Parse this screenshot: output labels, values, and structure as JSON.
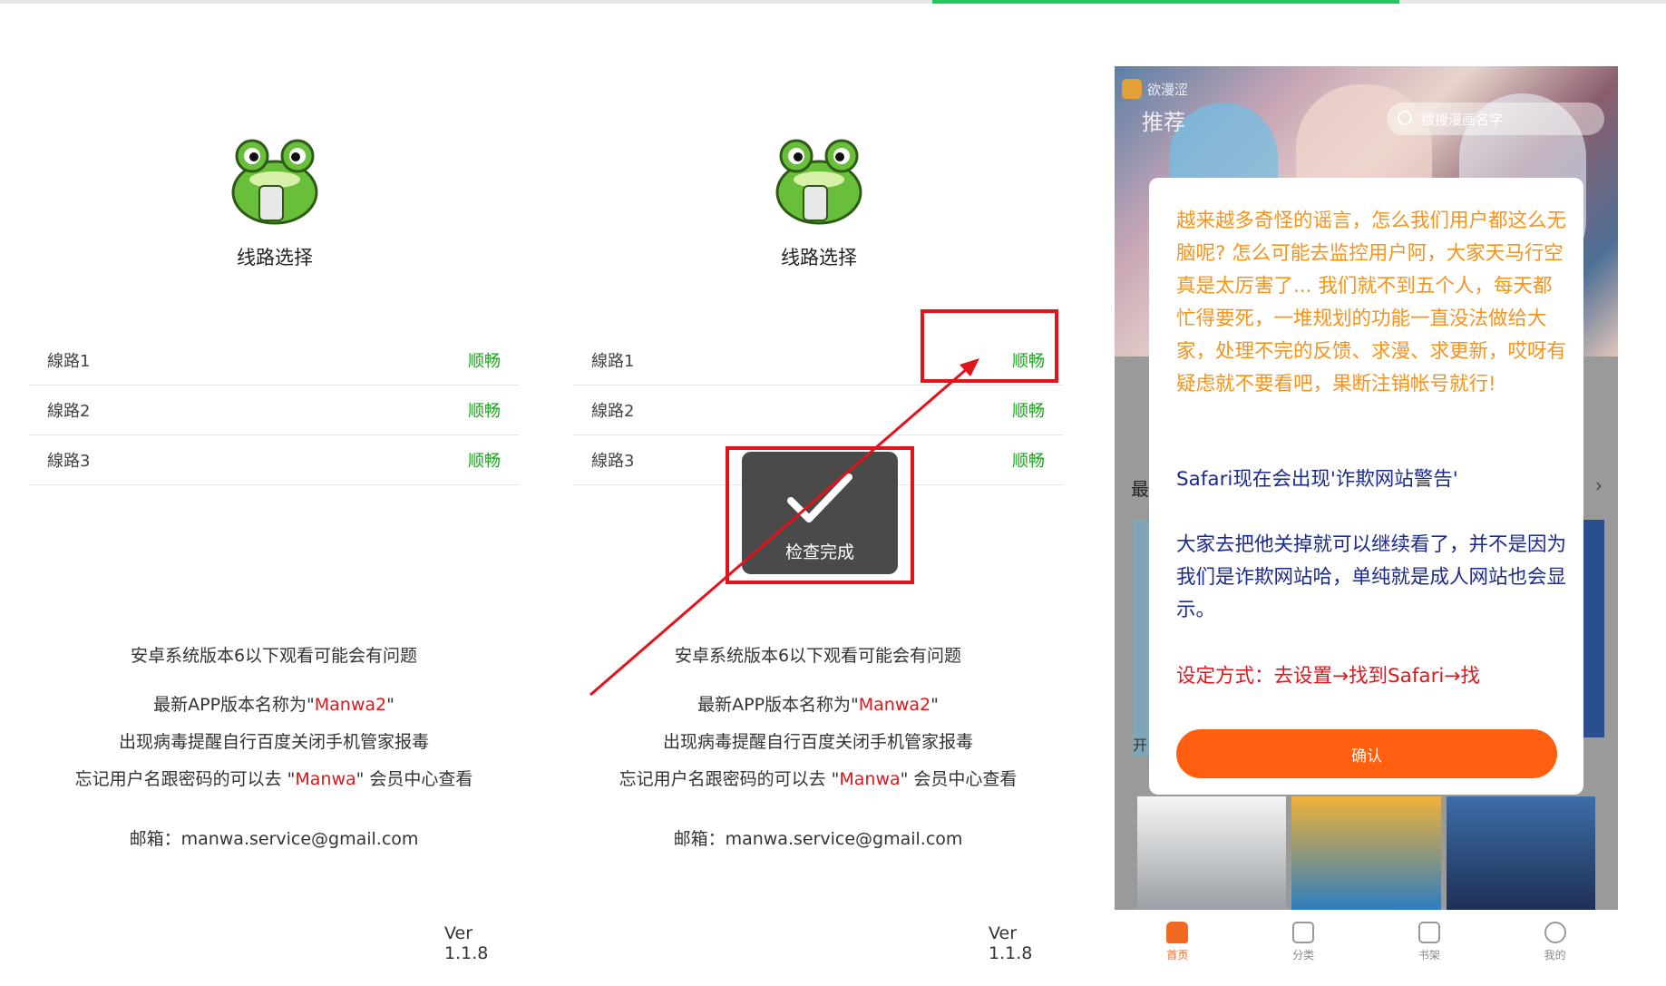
{
  "left_screen": {
    "title": "线路选择",
    "routes": [
      {
        "name": "線路1",
        "status": "顺畅"
      },
      {
        "name": "線路2",
        "status": "顺畅"
      },
      {
        "name": "線路3",
        "status": "顺畅"
      }
    ],
    "note1": "安卓系统版本6以下观看可能会有问题",
    "note2_pre": "最新APP版本名称为\"",
    "note2_red": "Manwa2",
    "note2_post": "\"",
    "note3": "出现病毒提醒自行百度关闭手机管家报毒",
    "note4_pre": "忘记用户名跟密码的可以去 \"",
    "note4_red": "Manwa",
    "note4_post": "\" 会员中心查看",
    "email": "邮箱：manwa.service@gmail.com",
    "version": "Ver 1.1.8"
  },
  "middle_screen": {
    "title": "线路选择",
    "routes": [
      {
        "name": "線路1",
        "status": "顺畅"
      },
      {
        "name": "線路2",
        "status": "顺畅"
      },
      {
        "name": "線路3",
        "status": "顺畅"
      }
    ],
    "toast": "检查完成",
    "note1": "安卓系统版本6以下观看可能会有问题",
    "note2_pre": "最新APP版本名称为\"",
    "note2_red": "Manwa2",
    "note2_post": "\"",
    "note3": "出现病毒提醒自行百度关闭手机管家报毒",
    "note4_pre": "忘记用户名跟密码的可以去 \"",
    "note4_red": "Manwa",
    "note4_post": "\" 会员中心查看",
    "email": "邮箱：manwa.service@gmail.com",
    "version": "Ver 1.1.8"
  },
  "phone": {
    "brand": "欲漫涩",
    "tab_recommend": "推荐",
    "search_placeholder": "搜搜漫画名字",
    "section_left": "最",
    "section_arrow": "›",
    "caption_left": "开",
    "dialog": {
      "orange_text": "越来越多奇怪的谣言，怎么我们用户都这么无脑呢? 怎么可能去监控用户阿，大家天马行空真是太厉害了... 我们就不到五个人，每天都忙得要死，一堆规划的功能一直没法做给大家，处理不完的反馈、求漫、求更新，哎呀有疑虑就不要看吧，果断注销帐号就行!",
      "navy_text1": "Safari现在会出现'诈欺网站警告'",
      "navy_text2": "大家去把他关掉就可以继续看了，并不是因为我们是诈欺网站哈，单纯就是成人网站也会显示。",
      "red_text": "设定方式：去设置→找到Safari→找",
      "confirm": "确认"
    },
    "tabs": [
      {
        "label": "首页",
        "active": true
      },
      {
        "label": "分类",
        "active": false
      },
      {
        "label": "书架",
        "active": false
      },
      {
        "label": "我的",
        "active": false
      }
    ]
  },
  "colors": {
    "status_green": "#1aa51a",
    "highlight_red": "#e3121b",
    "accent_orange": "#ff5f0e",
    "progress_green": "#22c55e"
  }
}
